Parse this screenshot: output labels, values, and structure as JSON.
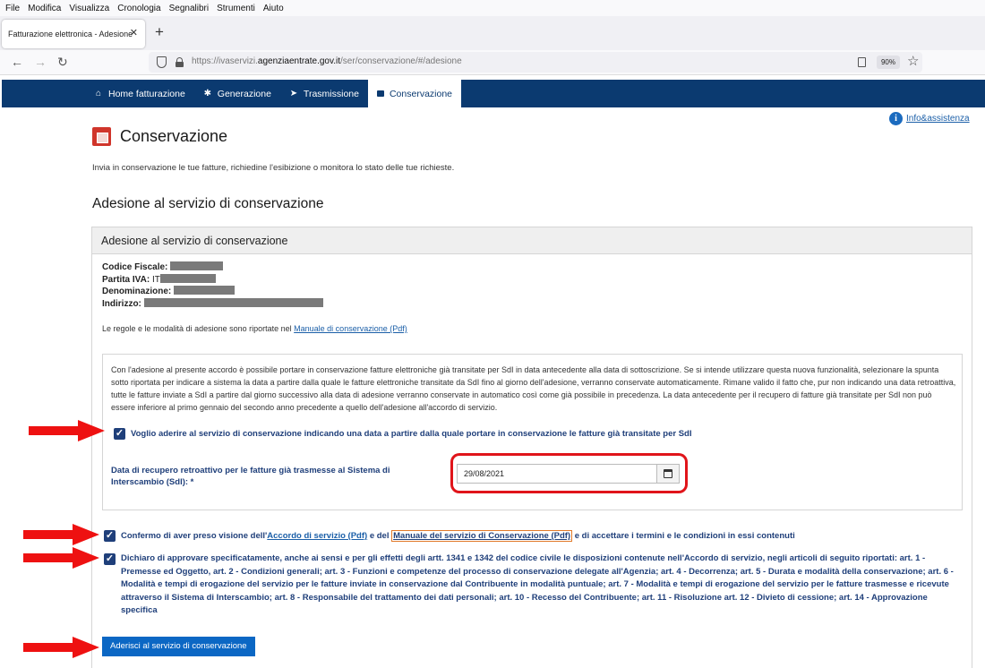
{
  "browser": {
    "menu": [
      "File",
      "Modifica",
      "Visualizza",
      "Cronologia",
      "Segnalibri",
      "Strumenti",
      "Aiuto"
    ],
    "tab_title": "Fatturazione elettronica - Adesione",
    "url_prefix": "https://ivaservizi.",
    "url_domain": "agenziaentrate.gov.it",
    "url_path": "/ser/conservazione/#/adesione",
    "zoom": "90%"
  },
  "nav": {
    "items": [
      {
        "label": "Home fatturazione",
        "icon": "home-icon"
      },
      {
        "label": "Generazione",
        "icon": "gear-icon"
      },
      {
        "label": "Trasmissione",
        "icon": "paper-plane-icon"
      },
      {
        "label": "Conservazione",
        "icon": "archive-box-icon",
        "active": true
      }
    ]
  },
  "info_link": "Info&assistenza",
  "page": {
    "title": "Conservazione",
    "description": "Invia in conservazione le tue fatture, richiedine l'esibizione o monitora lo stato delle tue richieste.",
    "section_title": "Adesione al servizio di conservazione"
  },
  "panel": {
    "header": "Adesione al servizio di conservazione",
    "fields": {
      "codice_fiscale_label": "Codice Fiscale:",
      "partita_iva_label": "Partita IVA:",
      "partita_iva_prefix": "IT",
      "denominazione_label": "Denominazione:",
      "indirizzo_label": "Indirizzo:"
    },
    "rules_text": "Le regole e le modalità di adesione sono riportate nel",
    "rules_link": "Manuale di conservazione (Pdf)",
    "retro_text": "Con l'adesione al presente accordo è possibile portare in conservazione fatture elettroniche già transitate per SdI in data antecedente alla data di sottoscrizione. Se si intende utilizzare questa nuova funzionalità, selezionare la spunta sotto riportata per indicare a sistema la data a partire dalla quale le fatture elettroniche transitate da SdI fino al giorno dell'adesione, verranno conservate automaticamente. Rimane valido il fatto che, pur non indicando una data retroattiva, tutte le fatture inviate a SdI a partire dal giorno successivo alla data di adesione verranno conservate in automatico così come già possibile in precedenza. La data antecedente per il recupero di fatture già transitate per SdI non può essere inferiore al primo gennaio del secondo anno precedente a quello dell'adesione all'accordo di servizio.",
    "retro_checkbox": "Voglio aderire al servizio di conservazione indicando una data a partire dalla quale portare in conservazione le fatture già transitate per SdI",
    "date_label": "Data di recupero retroattivo per le fatture già trasmesse al Sistema di Interscambio (SdI): *",
    "date_value": "29/08/2021",
    "confirm_pre": "Confermo di aver preso visione dell'",
    "confirm_link1": "Accordo di servizio (Pdf)",
    "confirm_mid": " e del ",
    "confirm_link2": "Manuale del servizio di Conservazione (Pdf)",
    "confirm_post": " e di accettare i termini e le condizioni in essi contenuti",
    "approve_text": "Dichiaro di approvare specificatamente, anche ai sensi e per gli effetti degli artt. 1341 e 1342 del codice civile le disposizioni contenute nell'Accordo di servizio, negli articoli di seguito riportati: art. 1 - Premesse ed Oggetto, art. 2 - Condizioni generali; art. 3 - Funzioni e competenze del processo di conservazione delegate all'Agenzia; art. 4 - Decorrenza; art. 5 - Durata e modalità della conservazione; art. 6 - Modalità e tempi di erogazione del servizio per le fatture inviate in conservazione dal Contribuente in modalità puntuale; art. 7 - Modalità e tempi di erogazione del servizio per le fatture trasmesse e ricevute attraverso il Sistema di Interscambio; art. 8 - Responsabile del trattamento dei dati personali; art. 10 - Recesso del Contribuente; art. 11 - Risoluzione art. 12 - Divieto di cessione; art. 14 - Approvazione specifica",
    "submit_label": "Aderisci al servizio di conservazione"
  },
  "colors": {
    "nav_bg": "#0b3a70",
    "accent_blue": "#1f3f7a",
    "button_blue": "#0b67c4",
    "highlight_red": "#e0141a"
  }
}
